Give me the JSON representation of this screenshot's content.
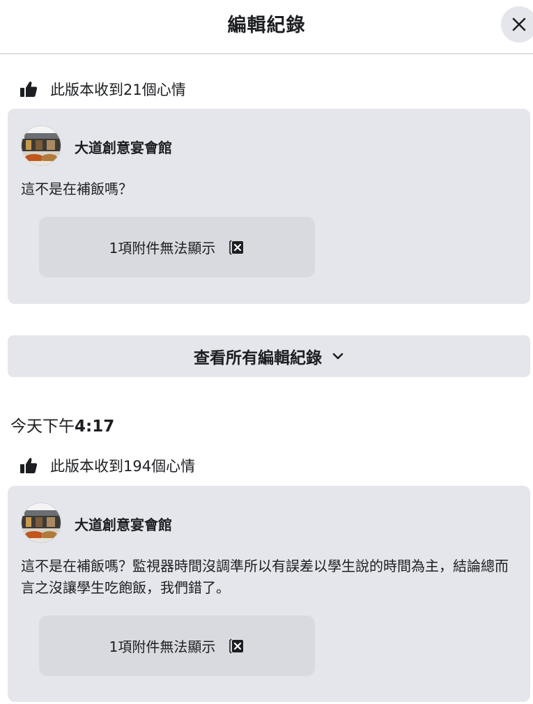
{
  "header": {
    "title": "編輯紀錄",
    "close_icon": "close-icon"
  },
  "versions_top": {
    "reactions_label": "此版本收到21個心情",
    "page_name": "大道創意宴會館",
    "post_text": "這不是在補飯嗎？",
    "attachment_label": "1項附件無法顯示"
  },
  "view_all": {
    "label": "查看所有編輯紀錄",
    "icon": "chevron-down-icon"
  },
  "timestamp": {
    "prefix": "今天下午",
    "time": "4:17"
  },
  "versions_bottom": {
    "reactions_label": "此版本收到194個心情",
    "page_name": "大道創意宴會館",
    "post_text": "這不是在補飯嗎？監視器時間沒調準所以有誤差以學生說的時間為主，結論總而言之沒讓學生吃飽飯，我們錯了。",
    "attachment_label": "1項附件無法顯示"
  },
  "colors": {
    "card_bg": "#e4e6eb",
    "attachment_bg": "#d8dadf",
    "text": "#1c1e21"
  }
}
